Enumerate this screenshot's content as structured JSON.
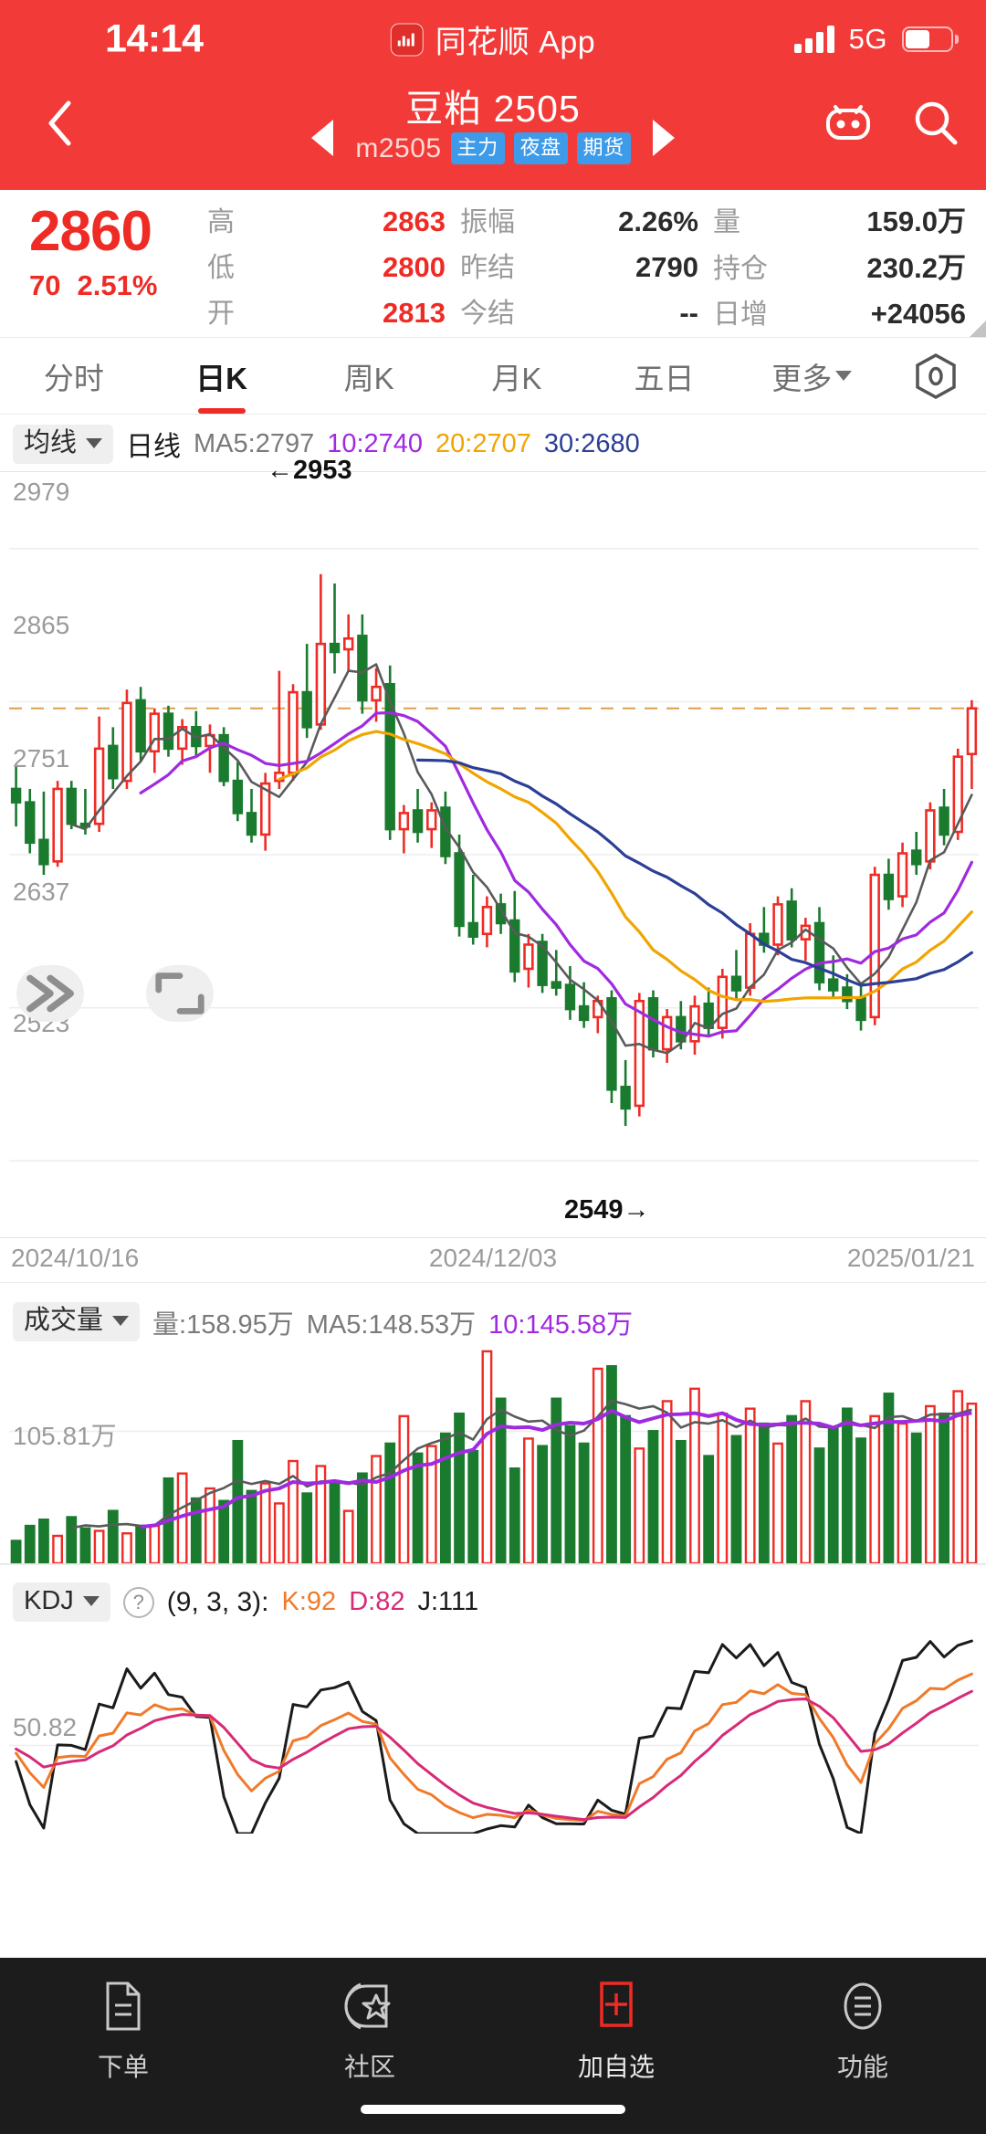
{
  "status_bar": {
    "time": "14:14",
    "app_name": "同花顺 App",
    "network": "5G",
    "app_logo_icon": "candlestick-app-icon",
    "signal_icon": "signal-bars-icon",
    "battery_icon": "battery-icon"
  },
  "navbar": {
    "back_icon": "chevron-left-icon",
    "prev_icon": "triangle-left-icon",
    "next_icon": "triangle-right-icon",
    "title": "豆粕 2505",
    "code": "m2505",
    "tags": [
      "主力",
      "夜盘",
      "期货"
    ],
    "robot_icon": "ai-robot-icon",
    "search_icon": "search-icon"
  },
  "quote": {
    "last_price": "2860",
    "change": "70",
    "change_pct": "2.51%",
    "fields": [
      {
        "label": "高",
        "value": "2863",
        "tone": "up"
      },
      {
        "label": "低",
        "value": "2800",
        "tone": "up"
      },
      {
        "label": "开",
        "value": "2813",
        "tone": "up"
      },
      {
        "label": "振幅",
        "value": "2.26%",
        "tone": "dk"
      },
      {
        "label": "昨结",
        "value": "2790",
        "tone": "dk"
      },
      {
        "label": "今结",
        "value": "--",
        "tone": "dk"
      },
      {
        "label": "量",
        "value": "159.0万",
        "tone": "dk"
      },
      {
        "label": "持仓",
        "value": "230.2万",
        "tone": "dk"
      },
      {
        "label": "日增",
        "value": "+24056",
        "tone": "dk"
      }
    ]
  },
  "period_tabs": {
    "items": [
      {
        "label": "分时",
        "active": false
      },
      {
        "label": "日K",
        "active": true
      },
      {
        "label": "周K",
        "active": false
      },
      {
        "label": "月K",
        "active": false
      },
      {
        "label": "五日",
        "active": false
      },
      {
        "label": "更多",
        "active": false,
        "has_caret": true
      }
    ],
    "settings_icon": "hexagon-settings-icon"
  },
  "ma_legend": {
    "selector_label": "均线",
    "period_label": "日线",
    "ma5": "MA5:2797",
    "ma10": "10:2740",
    "ma20": "20:2707",
    "ma30": "30:2680"
  },
  "price_chart": {
    "y_labels": [
      "2979",
      "2865",
      "2751",
      "2637",
      "2523"
    ],
    "x_labels": [
      "2024/10/16",
      "2024/12/03",
      "2025/01/21"
    ],
    "annotation_high": "←2953",
    "annotation_low": "2549→",
    "expand_icon": "double-chevron-right-icon",
    "fullscreen_icon": "fullscreen-corner-icon"
  },
  "volume_legend": {
    "selector_label": "成交量",
    "volume": "量:158.95万",
    "ma5": "MA5:148.53万",
    "ma10": "10:145.58万",
    "y_label": "105.81万"
  },
  "kdj_legend": {
    "selector_label": "KDJ",
    "help_icon": "question-circle-icon",
    "params": "(9, 3, 3):",
    "k": "K:92",
    "d": "D:82",
    "j": "J:111",
    "y_label": "50.82"
  },
  "bottom_nav": {
    "items": [
      {
        "label": "下单",
        "icon": "order-document-icon",
        "accent": false
      },
      {
        "label": "社区",
        "icon": "community-star-icon",
        "accent": false
      },
      {
        "label": "加自选",
        "icon": "add-watchlist-icon",
        "accent": true
      },
      {
        "label": "功能",
        "icon": "function-menu-icon",
        "accent": false
      }
    ],
    "accent_color": "#ef2b25"
  },
  "colors": {
    "brand_red": "#f23b38",
    "up_red": "#ef2b25",
    "down_green": "#1a7a2e",
    "ma5_gray": "#5a5a5a",
    "ma10_purple": "#a02ae0",
    "ma20_orange": "#f0a500",
    "ma30_navy": "#2b3f96",
    "kdj_k": "#f07a2a",
    "kdj_d": "#d72a77",
    "kdj_j": "#1b1b1b"
  },
  "chart_data": {
    "type": "line",
    "title": "豆粕 2505 日K",
    "panes": [
      {
        "name": "candlestick",
        "type": "candlestick",
        "ylim": [
          2466,
          3036
        ],
        "yticks": [
          2979,
          2865,
          2751,
          2637,
          2523
        ],
        "x_start": "2024/10/16",
        "x_mid": "2024/12/03",
        "x_end": "2025/01/21",
        "prev_close_line": 2860,
        "high_marker": 2953,
        "low_marker": 2549,
        "ohlc": [
          [
            2800,
            2818,
            2772,
            2790
          ],
          [
            2790,
            2800,
            2752,
            2760
          ],
          [
            2762,
            2798,
            2736,
            2744
          ],
          [
            2746,
            2806,
            2742,
            2800
          ],
          [
            2800,
            2806,
            2770,
            2774
          ],
          [
            2774,
            2800,
            2766,
            2772
          ],
          [
            2774,
            2854,
            2768,
            2830
          ],
          [
            2832,
            2846,
            2800,
            2808
          ],
          [
            2806,
            2874,
            2800,
            2864
          ],
          [
            2866,
            2876,
            2820,
            2828
          ],
          [
            2828,
            2860,
            2812,
            2856
          ],
          [
            2856,
            2862,
            2824,
            2830
          ],
          [
            2830,
            2852,
            2818,
            2846
          ],
          [
            2846,
            2858,
            2824,
            2832
          ],
          [
            2832,
            2848,
            2812,
            2840
          ],
          [
            2840,
            2846,
            2802,
            2806
          ],
          [
            2806,
            2820,
            2776,
            2782
          ],
          [
            2782,
            2800,
            2760,
            2766
          ],
          [
            2766,
            2812,
            2754,
            2804
          ],
          [
            2806,
            2888,
            2800,
            2812
          ],
          [
            2812,
            2878,
            2806,
            2872
          ],
          [
            2872,
            2908,
            2838,
            2846
          ],
          [
            2848,
            2960,
            2844,
            2908
          ],
          [
            2908,
            2953,
            2886,
            2902
          ],
          [
            2904,
            2930,
            2888,
            2912
          ],
          [
            2914,
            2930,
            2856,
            2866
          ],
          [
            2866,
            2890,
            2850,
            2876
          ],
          [
            2878,
            2892,
            2762,
            2770
          ],
          [
            2770,
            2788,
            2752,
            2782
          ],
          [
            2784,
            2800,
            2760,
            2768
          ],
          [
            2770,
            2790,
            2756,
            2784
          ],
          [
            2786,
            2798,
            2744,
            2750
          ],
          [
            2752,
            2766,
            2690,
            2698
          ],
          [
            2700,
            2736,
            2684,
            2690
          ],
          [
            2692,
            2720,
            2682,
            2712
          ],
          [
            2714,
            2722,
            2692,
            2700
          ],
          [
            2702,
            2724,
            2656,
            2664
          ],
          [
            2666,
            2692,
            2652,
            2684
          ],
          [
            2686,
            2692,
            2648,
            2654
          ],
          [
            2656,
            2680,
            2646,
            2652
          ],
          [
            2654,
            2668,
            2628,
            2636
          ],
          [
            2638,
            2656,
            2622,
            2628
          ],
          [
            2630,
            2646,
            2618,
            2642
          ],
          [
            2644,
            2650,
            2566,
            2576
          ],
          [
            2578,
            2598,
            2549,
            2562
          ],
          [
            2564,
            2648,
            2556,
            2642
          ],
          [
            2644,
            2650,
            2600,
            2606
          ],
          [
            2606,
            2636,
            2596,
            2630
          ],
          [
            2630,
            2642,
            2606,
            2612
          ],
          [
            2612,
            2646,
            2602,
            2638
          ],
          [
            2640,
            2652,
            2616,
            2622
          ],
          [
            2622,
            2666,
            2614,
            2660
          ],
          [
            2660,
            2680,
            2642,
            2650
          ],
          [
            2652,
            2700,
            2646,
            2692
          ],
          [
            2692,
            2712,
            2678,
            2684
          ],
          [
            2684,
            2720,
            2676,
            2714
          ],
          [
            2716,
            2726,
            2682,
            2688
          ],
          [
            2688,
            2704,
            2672,
            2698
          ],
          [
            2700,
            2712,
            2650,
            2656
          ],
          [
            2658,
            2676,
            2644,
            2650
          ],
          [
            2652,
            2662,
            2636,
            2642
          ],
          [
            2644,
            2654,
            2620,
            2628
          ],
          [
            2630,
            2742,
            2624,
            2736
          ],
          [
            2736,
            2748,
            2710,
            2718
          ],
          [
            2720,
            2760,
            2712,
            2752
          ],
          [
            2754,
            2768,
            2736,
            2744
          ],
          [
            2746,
            2790,
            2740,
            2784
          ],
          [
            2786,
            2800,
            2758,
            2766
          ],
          [
            2768,
            2830,
            2762,
            2824
          ],
          [
            2826,
            2866,
            2800,
            2860
          ]
        ],
        "ma5_last": 2797,
        "ma10_last": 2740,
        "ma20_last": 2707,
        "ma30_last": 2680
      },
      {
        "name": "volume",
        "type": "bar",
        "unit": "万",
        "ygrid_label": 105.81,
        "ygrid_value": 105.81,
        "ylim": [
          0,
          175
        ],
        "values": [
          18,
          30,
          35,
          22,
          37,
          28,
          26,
          42,
          24,
          30,
          30,
          68,
          72,
          52,
          60,
          50,
          98,
          58,
          64,
          48,
          82,
          56,
          78,
          66,
          42,
          72,
          86,
          96,
          118,
          88,
          94,
          104,
          120,
          90,
          170,
          132,
          76,
          100,
          94,
          132,
          110,
          96,
          156,
          158,
          118,
          92,
          106,
          130,
          98,
          140,
          86,
          120,
          102,
          124,
          112,
          96,
          118,
          130,
          92,
          108,
          124,
          100,
          118,
          136,
          112,
          104,
          126,
          120,
          138,
          128
        ],
        "ma5_last": 148.53,
        "ma10_last": 145.58
      },
      {
        "name": "kdj",
        "type": "line",
        "params": [
          9,
          3,
          3
        ],
        "ygrid_label": 50.82,
        "ylim": [
          0,
          120
        ],
        "series": [
          {
            "name": "K",
            "color": "#f07a2a",
            "last": 92
          },
          {
            "name": "D",
            "color": "#d72a77",
            "last": 82
          },
          {
            "name": "J",
            "color": "#1b1b1b",
            "last": 111
          }
        ]
      }
    ]
  }
}
